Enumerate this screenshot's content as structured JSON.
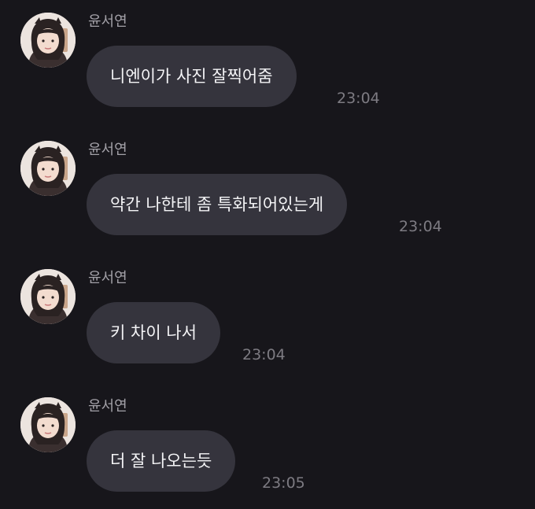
{
  "messages": [
    {
      "sender": "윤서연",
      "text": "니엔이가 사진 잘찍어줌",
      "time": "23:04"
    },
    {
      "sender": "윤서연",
      "text": "약간 나한테 좀 특화되어있는게",
      "time": "23:04"
    },
    {
      "sender": "윤서연",
      "text": "키 차이 나서",
      "time": "23:04"
    },
    {
      "sender": "윤서연",
      "text": "더 잘 나오는듯",
      "time": "23:05"
    }
  ]
}
